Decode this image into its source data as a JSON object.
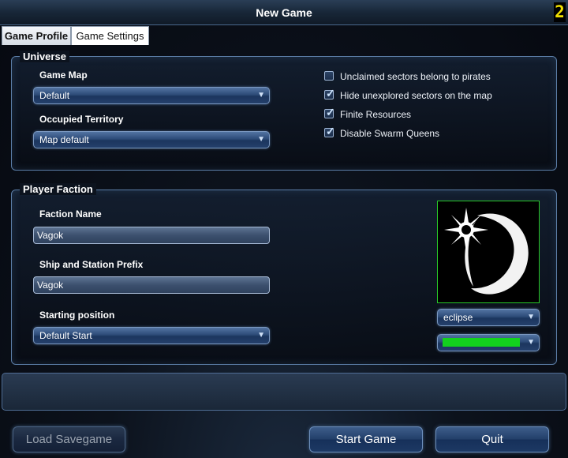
{
  "window": {
    "title": "New Game",
    "corner_badge": "2"
  },
  "tabs": [
    {
      "label": "Game Profile"
    },
    {
      "label": "Game Settings"
    }
  ],
  "universe": {
    "legend": "Universe",
    "game_map": {
      "label": "Game Map",
      "value": "Default"
    },
    "occupied_territory": {
      "label": "Occupied Territory",
      "value": "Map default"
    },
    "options": [
      {
        "label": "Unclaimed sectors belong to pirates",
        "checked": false
      },
      {
        "label": "Hide unexplored sectors on the map",
        "checked": true
      },
      {
        "label": "Finite Resources",
        "checked": true
      },
      {
        "label": "Disable Swarm Queens",
        "checked": true
      }
    ]
  },
  "player_faction": {
    "legend": "Player Faction",
    "faction_name": {
      "label": "Faction Name",
      "value": "Vagok"
    },
    "prefix": {
      "label": "Ship and Station Prefix",
      "value": "Vagok"
    },
    "starting_position": {
      "label": "Starting position",
      "value": "Default Start"
    },
    "emblem": {
      "icon": "eclipse-emblem-icon",
      "value": "eclipse"
    },
    "color": {
      "value": "#13d21e"
    }
  },
  "buttons": {
    "load": "Load Savegame",
    "start": "Start Game",
    "quit": "Quit"
  }
}
